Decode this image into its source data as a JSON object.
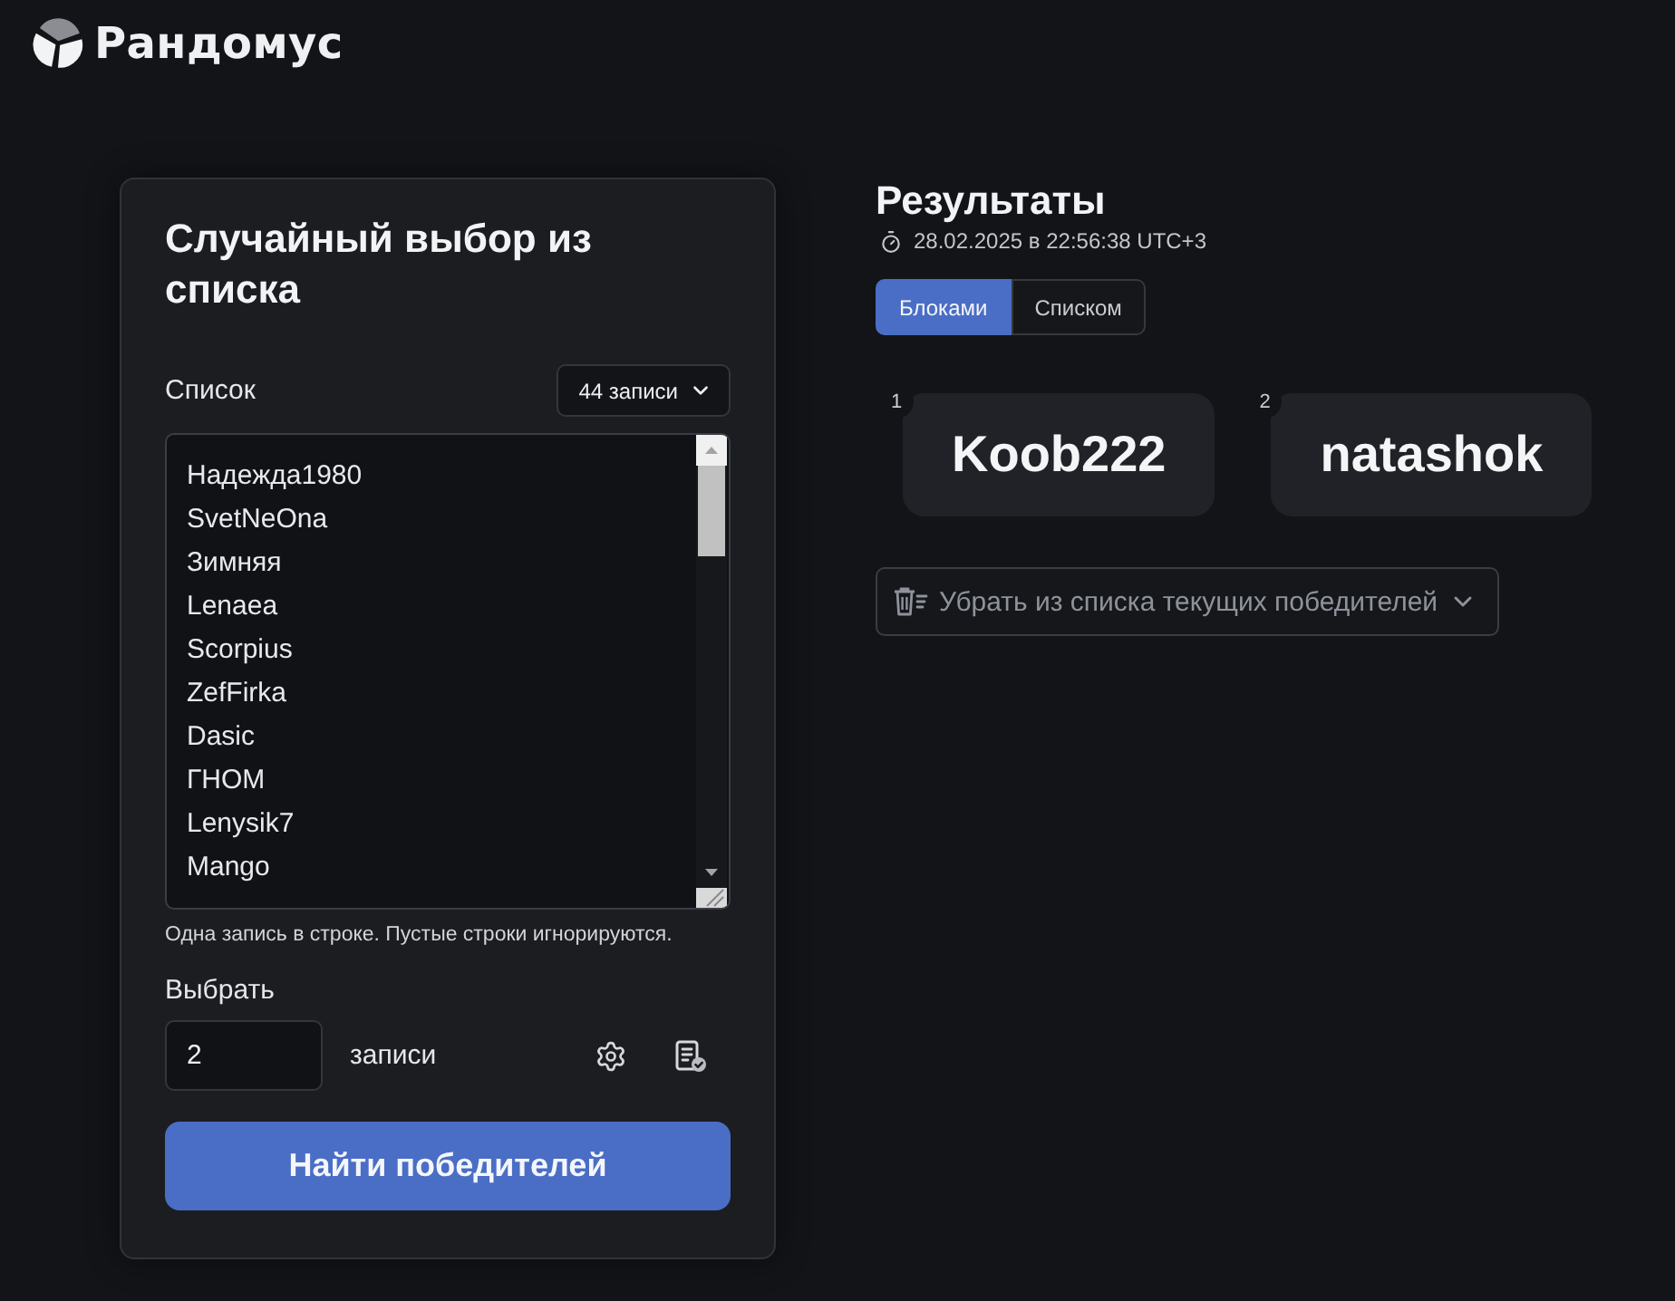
{
  "logo": {
    "text": "Рандомус"
  },
  "picker": {
    "title": "Случайный выбор из списка",
    "list_label": "Список",
    "count_button": "44 записи",
    "entries": [
      "Надежда1980",
      "SvetNeOna",
      "Зимняя",
      "Lenaea",
      "Scorpius",
      "ZefFirka",
      "Dasic",
      "ГНОМ",
      "Lenysik7",
      "Mango"
    ],
    "hint": "Одна запись в строке. Пустые строки игнорируются.",
    "pick_label": "Выбрать",
    "pick_count": "2",
    "pick_unit": "записи",
    "submit": "Найти победителей"
  },
  "results": {
    "title": "Результаты",
    "timestamp": "28.02.2025 в 22:56:38 UTC+3",
    "view_tabs": [
      {
        "label": "Блоками",
        "selected": true
      },
      {
        "label": "Списком",
        "selected": false
      }
    ],
    "winners": [
      {
        "rank": "1",
        "name": "Koob222"
      },
      {
        "rank": "2",
        "name": "natashok"
      }
    ],
    "remove_button": "Убрать из списка текущих победителей"
  }
}
